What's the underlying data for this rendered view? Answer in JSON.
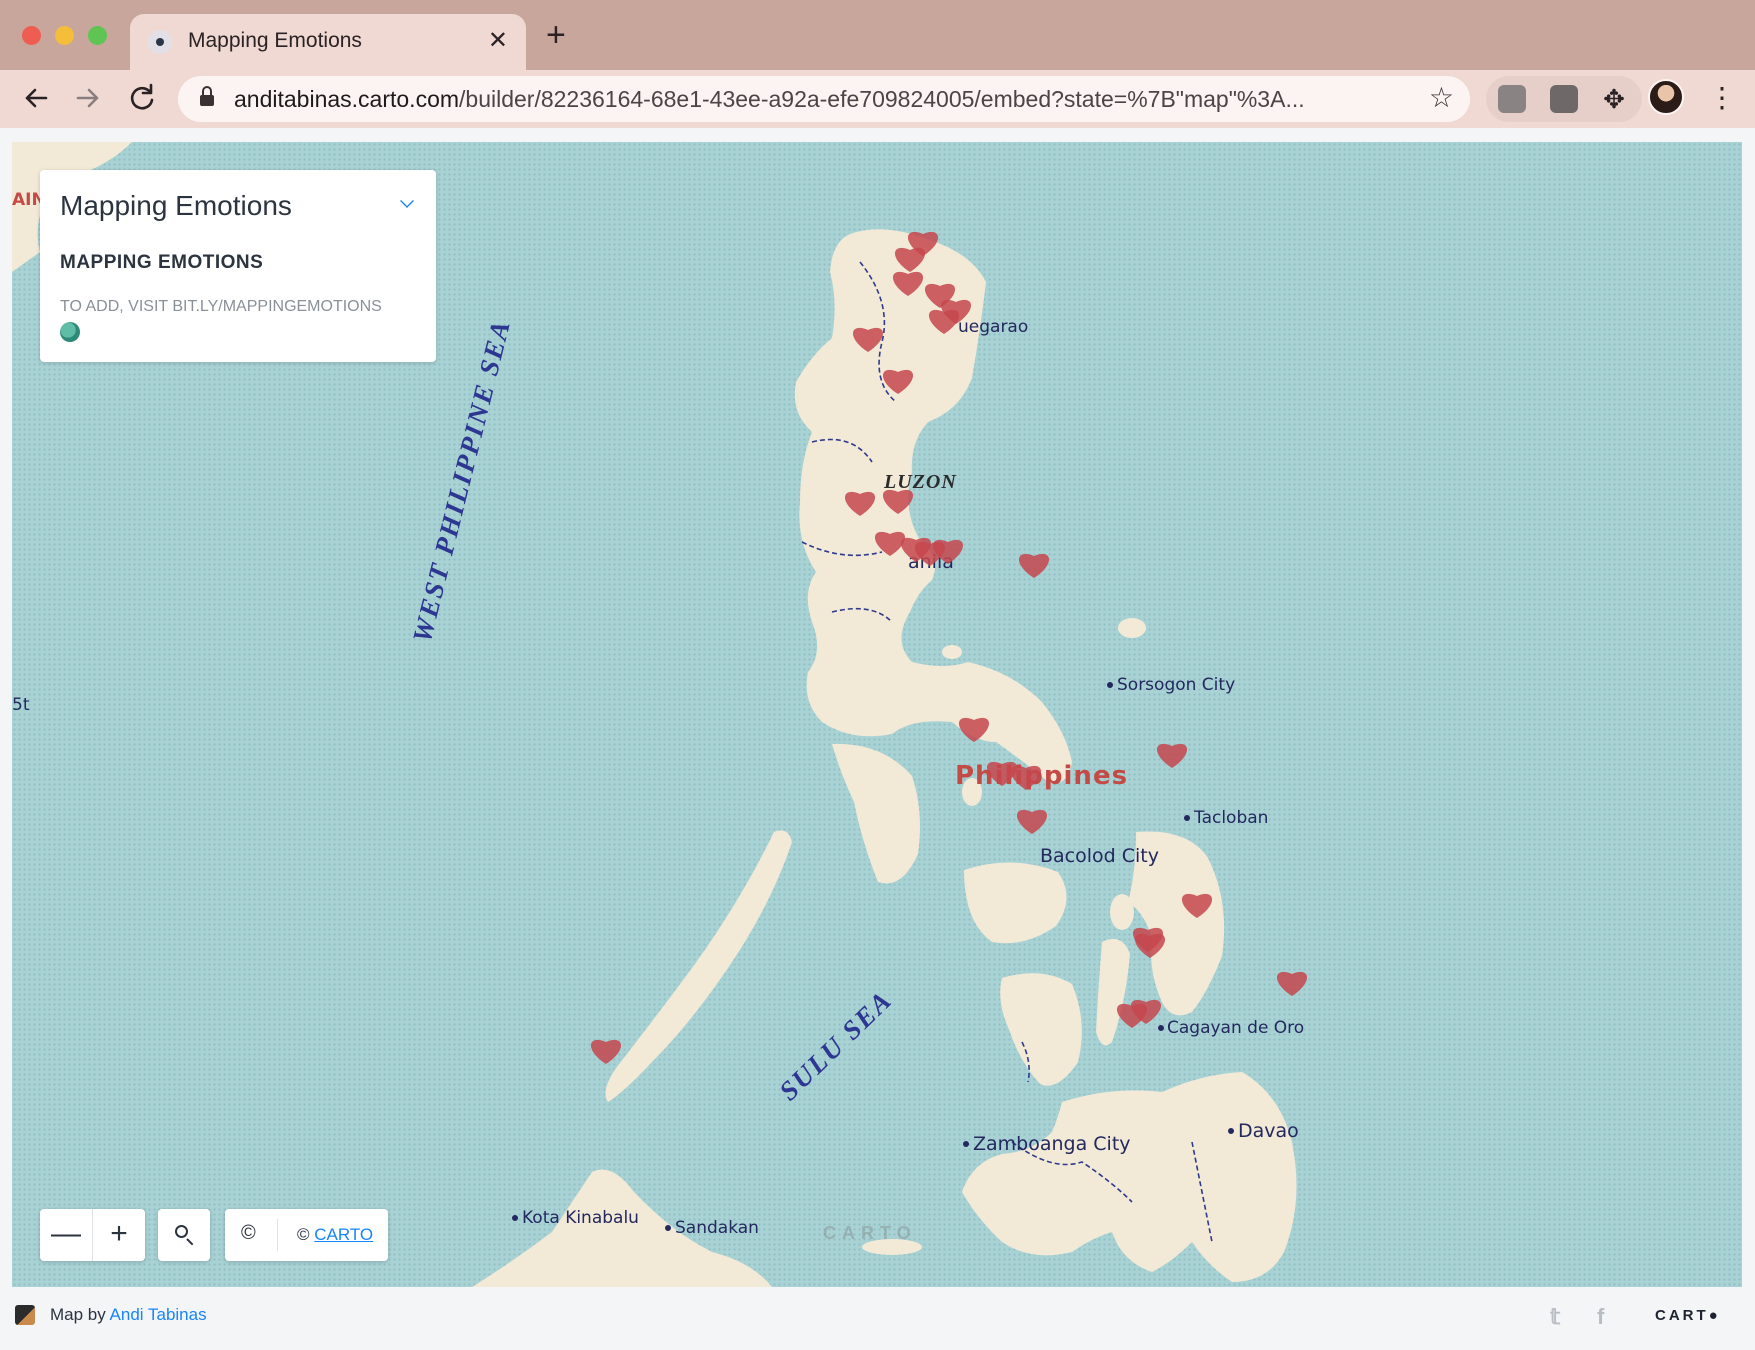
{
  "browser": {
    "tab_title": "Mapping Emotions",
    "tab_close": "✕",
    "new_tab": "+",
    "url_host": "anditabinas.carto.com",
    "url_path": "/builder/82236164-68e1-43ee-a92a-efe709824005/embed?state=%7B\"map\"%3A...",
    "back_icon": "arrow-left-icon",
    "forward_icon": "arrow-right-icon",
    "reload_icon": "reload-icon",
    "bookmark_icon": "star-icon",
    "extensions_icon": "puzzle-icon",
    "menu_icon": "kebab-icon",
    "colors": {
      "tabbar": "#c9a69b",
      "toolbar": "#f0d9d3"
    }
  },
  "legend": {
    "title": "Mapping Emotions",
    "subtitle": "MAPPING EMOTIONS",
    "description": "TO ADD, VISIT BIT.LY/MAPPINGEMOTIONS",
    "emoji_icon": "globe-emoji-icon",
    "toggle_icon": "chevron-down-icon"
  },
  "map": {
    "sea_labels": [
      "WEST PHILIPPINE SEA",
      "SULU SEA"
    ],
    "region_labels": [
      "LUZON"
    ],
    "country_label": "Philippines",
    "edge_labels": [
      "AIN",
      "5t"
    ],
    "city_labels": {
      "tuguegarao": "uegarao",
      "manila": "anila",
      "sorsogon": "Sorsogon City",
      "tacloban": "Tacloban",
      "bacolod": "Bacolod City",
      "cagayan": "Cagayan de Oro",
      "davao": "Davao",
      "zamboanga": "Zamboanga City",
      "kota_kinabalu": "Kota Kinabalu",
      "sandakan": "Sandakan"
    },
    "marker_icon": "heart-icon",
    "marker_color": "#c5464d",
    "marker_count": 27,
    "watermark": "CARTO"
  },
  "controls": {
    "zoom_out": "—",
    "zoom_in": "+",
    "search_icon": "search-icon",
    "attribution_icon": "©",
    "attribution_prefix": "© ",
    "attribution_link": "CARTO"
  },
  "footer": {
    "credit_prefix": "Map by ",
    "author": "Andi Tabinas",
    "twitter": "𝕥",
    "facebook": "f",
    "logo": "CART●"
  }
}
